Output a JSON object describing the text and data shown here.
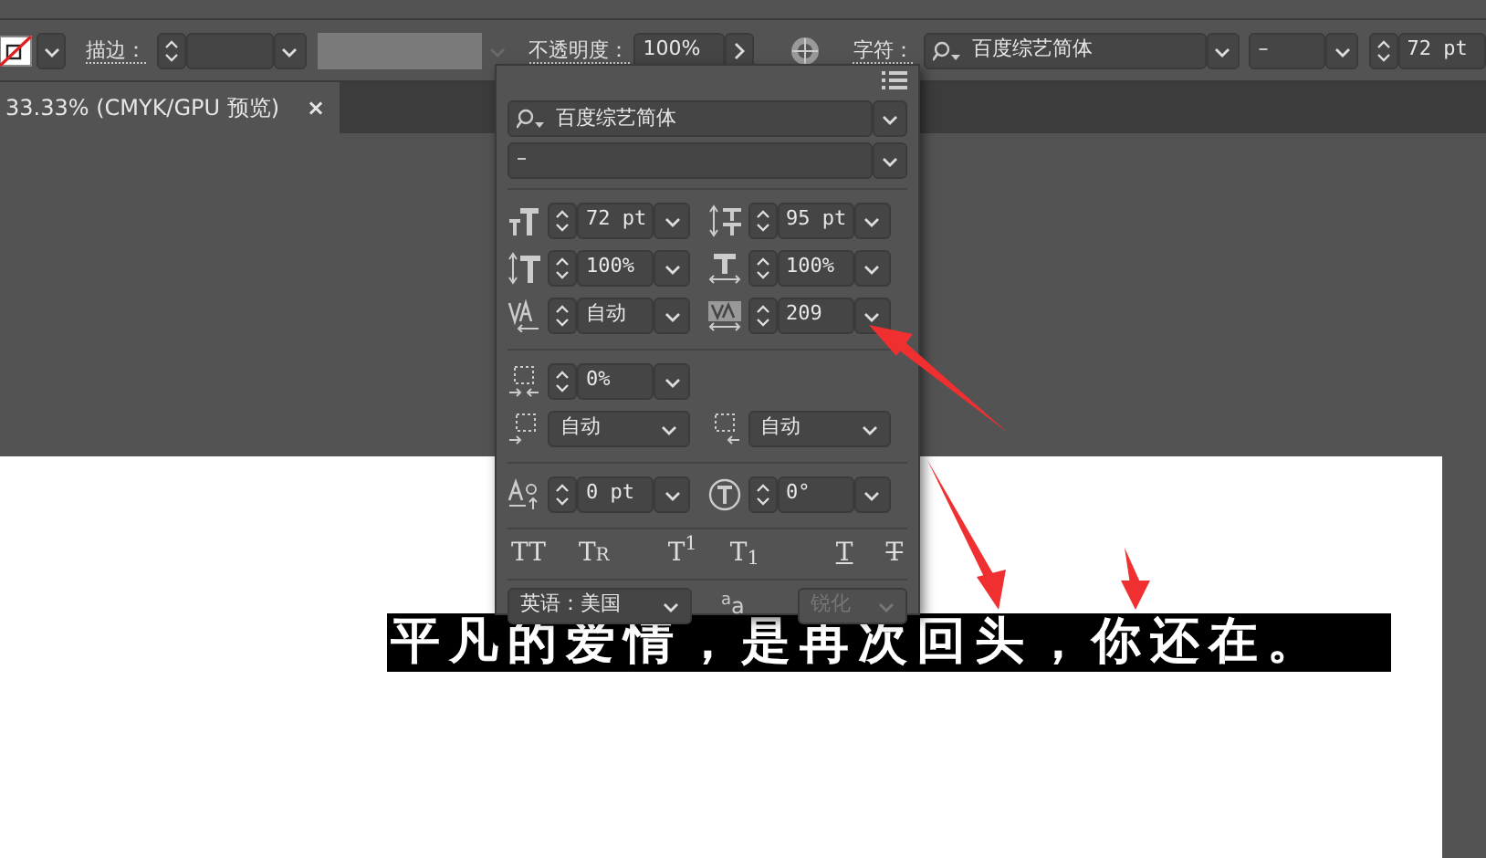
{
  "toolbar": {
    "stroke_label": "描边：",
    "opacity_label": "不透明度：",
    "opacity_value": "100%",
    "character_label": "字符：",
    "font": "百度综艺简体",
    "font_style": "–",
    "font_size": "72 pt"
  },
  "document_tab": {
    "title": "33.33% (CMYK/GPU 预览)",
    "close": "×"
  },
  "character_panel": {
    "font": "百度综艺简体",
    "font_style": "–",
    "sections": [
      [
        [
          {
            "kind": "spin",
            "value": "72 pt"
          },
          {
            "kind": "spin",
            "value": "95 pt"
          }
        ],
        [
          {
            "kind": "spin",
            "value": "100%"
          },
          {
            "kind": "spin",
            "value": "100%"
          }
        ],
        [
          {
            "kind": "spin",
            "value": "自动"
          },
          {
            "kind": "spin",
            "value": "209"
          }
        ]
      ],
      [
        [
          {
            "kind": "spin",
            "value": "0%"
          }
        ],
        [
          {
            "kind": "select",
            "value": "自动"
          },
          {
            "kind": "select",
            "value": "自动"
          }
        ]
      ],
      [
        [
          {
            "kind": "spin",
            "value": "0 pt"
          },
          {
            "kind": "spin",
            "value": "0°"
          }
        ]
      ]
    ],
    "style_buttons": [
      {
        "label": "TT",
        "kind": "plain"
      },
      {
        "label": "Tr",
        "kind": "smallcaps"
      },
      {
        "label": "T$^{1}$",
        "kind": "plain"
      },
      {
        "label": "T$_{1}$",
        "kind": "plain"
      },
      {
        "label": "T",
        "kind": "underline"
      },
      {
        "label": "T",
        "kind": "strike"
      }
    ],
    "language": "英语：美国",
    "antialias_glyph": "$^{a}$a",
    "antialias": {
      "value": "锐化",
      "disabled": true
    }
  },
  "artboard": {
    "text": "平凡的爱情，是再次回头，你还在。"
  }
}
